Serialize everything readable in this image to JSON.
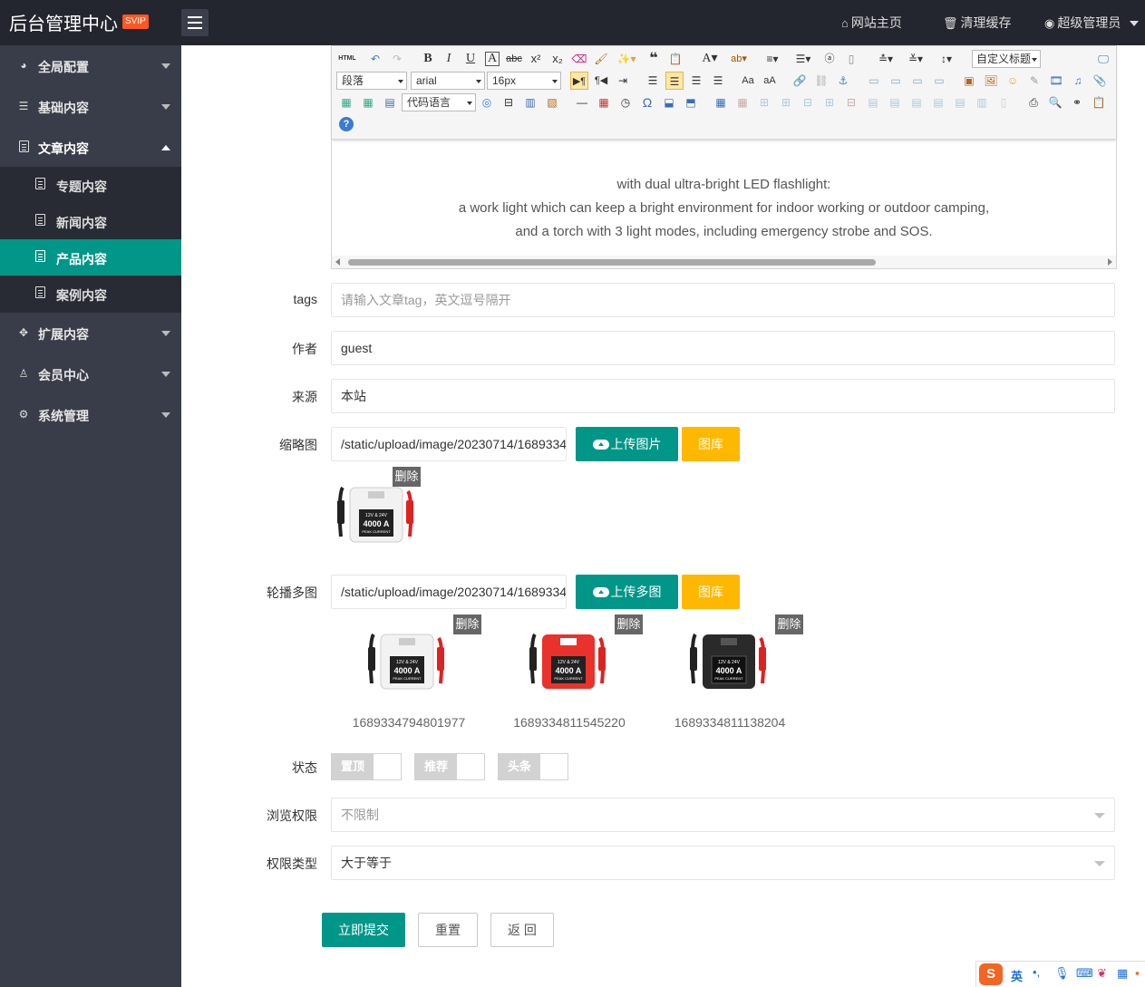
{
  "header": {
    "title": "后台管理中心",
    "badge": "SVIP",
    "nav": [
      {
        "label": "网站主页",
        "icon": "home-icon"
      },
      {
        "label": "清理缓存",
        "icon": "trash-icon"
      },
      {
        "label": "超级管理员",
        "icon": "user-icon"
      }
    ]
  },
  "sidebar": {
    "items": [
      {
        "label": "全局配置",
        "icon": "globe-icon"
      },
      {
        "label": "基础内容",
        "icon": "sliders-icon"
      },
      {
        "label": "文章内容",
        "icon": "file-icon"
      },
      {
        "label": "扩展内容",
        "icon": "expand-icon"
      },
      {
        "label": "会员中心",
        "icon": "user-icon"
      },
      {
        "label": "系统管理",
        "icon": "gear-icon"
      }
    ],
    "subitems": [
      {
        "label": "专题内容"
      },
      {
        "label": "新闻内容"
      },
      {
        "label": "产品内容",
        "active": true
      },
      {
        "label": "案例内容"
      }
    ]
  },
  "editor": {
    "toolbar": {
      "html": "HTML",
      "custom_title": "自定义标题",
      "paragraph": "段落",
      "font": "arial",
      "size": "16px",
      "code_lang": "代码语言"
    },
    "content": [
      "with dual ultra-bright  LED flashlight:",
      "a work light which can keep a bright environment for indoor working or outdoor camping,",
      "and a torch with 3 light modes, including emergency strobe and SOS."
    ]
  },
  "form": {
    "tags": {
      "label": "tags",
      "placeholder": "请输入文章tag，英文逗号隔开",
      "value": ""
    },
    "author": {
      "label": "作者",
      "value": "guest"
    },
    "source": {
      "label": "来源",
      "value": "本站"
    },
    "thumbnail": {
      "label": "缩略图",
      "value": "/static/upload/image/20230714/1689334",
      "upload_label": "上传图片",
      "gallery_label": "图库",
      "delete_label": "删除",
      "image_text": [
        "12V & 24V",
        "4000 A",
        "PEAK CURRENT"
      ]
    },
    "carousel": {
      "label": "轮播多图",
      "value": "/static/upload/image/20230714/1689334",
      "upload_label": "上传多图",
      "gallery_label": "图库",
      "images": [
        {
          "caption": "1689334794801977",
          "delete_label": "删除",
          "color": "#f2f2f2"
        },
        {
          "caption": "1689334811545220",
          "delete_label": "删除",
          "color": "#e8322b"
        },
        {
          "caption": "1689334811138204",
          "delete_label": "删除",
          "color": "#2a2a2a"
        }
      ]
    },
    "status": {
      "label": "状态",
      "switches": [
        "置顶",
        "推荐",
        "头条"
      ]
    },
    "permission": {
      "label": "浏览权限",
      "value": "不限制"
    },
    "permission_type": {
      "label": "权限类型",
      "value": "大于等于"
    },
    "buttons": {
      "submit": "立即提交",
      "reset": "重置",
      "back": "返 回"
    }
  },
  "ime": {
    "lang": "英"
  },
  "colors": {
    "primary": "#009688",
    "warning": "#ffb800",
    "sidebar": "#393d49",
    "header": "#23262e",
    "badge": "#ff5722"
  }
}
